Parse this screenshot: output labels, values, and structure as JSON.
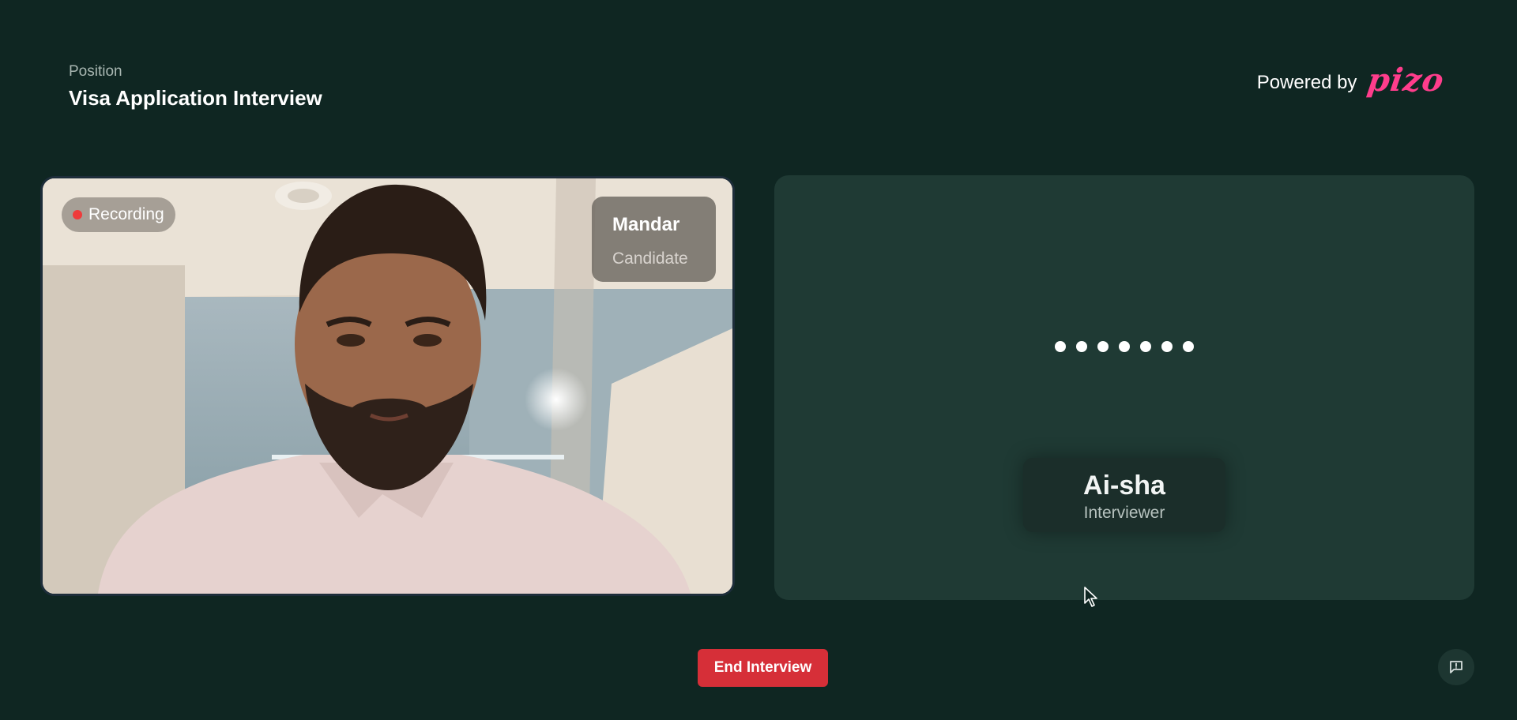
{
  "header": {
    "position_label": "Position",
    "position_title": "Visa Application Interview",
    "powered_by": "Powered by",
    "brand": "pizo"
  },
  "candidate": {
    "recording_label": "Recording",
    "name": "Mandar",
    "role": "Candidate"
  },
  "interviewer": {
    "name": "Ai-sha",
    "role": "Interviewer",
    "status": "speaking-dots"
  },
  "controls": {
    "end_label": "End Interview",
    "feedback_icon": "feedback-icon"
  },
  "colors": {
    "background": "#0f2622",
    "panel": "#1f3a34",
    "accent_red": "#d62f38",
    "brand_pink": "#ff3d8c",
    "recording_dot": "#ef3b3b"
  }
}
